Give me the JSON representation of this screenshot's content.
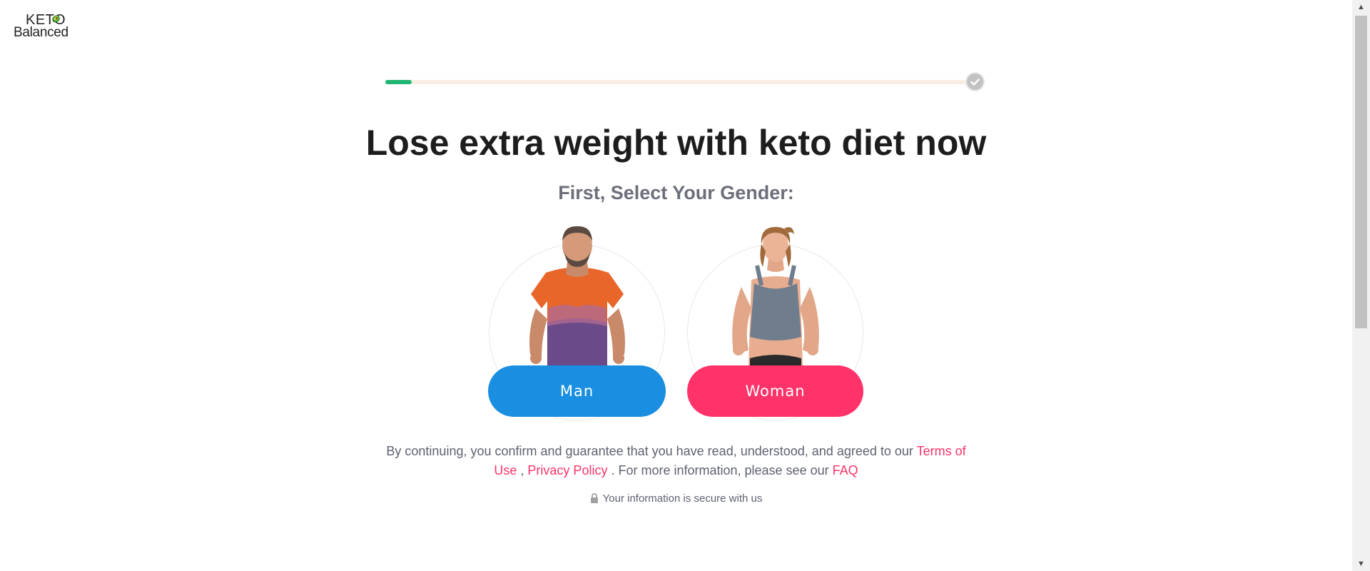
{
  "logo": {
    "line1": "KETO",
    "line2": "Balanced"
  },
  "progress": {
    "value": 0.045,
    "fill_color": "#21b573",
    "track_color": "#faeee2",
    "end_icon": "check-icon"
  },
  "title": "Lose extra weight with keto diet now",
  "subtitle": "First, Select Your Gender:",
  "options": {
    "man": {
      "label": "Man",
      "color": "#1a8ee0"
    },
    "woman": {
      "label": "Woman",
      "color": "#ff3369"
    }
  },
  "consent": {
    "text_before": "By continuing, you confirm and guarantee that you have read, understood, and agreed to our ",
    "terms": "Terms of Use",
    "sep": " , ",
    "privacy": "Privacy Policy",
    "text_after": " . For more information, please see our ",
    "faq": "FAQ"
  },
  "secure_note": {
    "icon": "lock-icon",
    "text": "Your information is secure with us"
  },
  "scrollbar": {
    "up_icon": "arrow-up-icon",
    "down_icon": "arrow-down-icon"
  }
}
